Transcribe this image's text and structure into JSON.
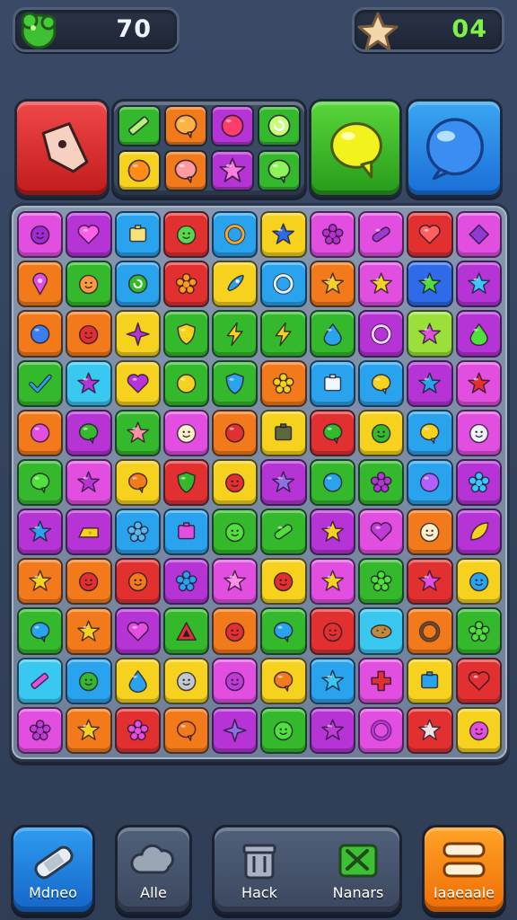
{
  "hud": {
    "score_icon": "green-blob-icon",
    "score_value": "70",
    "moves_icon": "star-icon",
    "moves_value": "04"
  },
  "boosters": [
    {
      "name": "red-tag-booster",
      "icon": "tag-icon",
      "color": "#e23333"
    },
    {
      "name": "mini-gems-booster",
      "icon": "gem-cluster-icon",
      "color": "#3a4a62"
    },
    {
      "name": "green-bubble-booster",
      "icon": "speech-bubble-icon",
      "color": "#3cc02a"
    },
    {
      "name": "blue-orb-booster",
      "icon": "orb-icon",
      "color": "#2b8ae8"
    }
  ],
  "booster_gems": [
    {
      "bg": "#35b92c",
      "icon": "pencil",
      "fg": "#b6f07a"
    },
    {
      "bg": "#f27a1b",
      "icon": "bubble",
      "fg": "#ffb347"
    },
    {
      "bg": "#b633d6",
      "icon": "circle",
      "fg": "#ff3d6b"
    },
    {
      "bg": "#35b92c",
      "icon": "swirl",
      "fg": "#c8ff7a"
    },
    {
      "bg": "#f6d21e",
      "icon": "circle",
      "fg": "#ff8b18"
    },
    {
      "bg": "#f27a1b",
      "icon": "bubble",
      "fg": "#ff9aa0"
    },
    {
      "bg": "#b633d6",
      "icon": "star",
      "fg": "#ff7ce0"
    },
    {
      "bg": "#35b92c",
      "icon": "bubble",
      "fg": "#8ff25a"
    }
  ],
  "board": {
    "rows": [
      [
        {
          "bg": "#e24fe0",
          "fg": "#a02bd0",
          "icon": "face"
        },
        {
          "bg": "#b633d6",
          "fg": "#ff5fe8",
          "icon": "heart"
        },
        {
          "bg": "#2aa3ee",
          "fg": "#f7e27a",
          "icon": "box"
        },
        {
          "bg": "#e23030",
          "fg": "#5ad84a",
          "icon": "face"
        },
        {
          "bg": "#2aa3ee",
          "fg": "#f7a62d",
          "icon": "ring"
        },
        {
          "bg": "#f6d21e",
          "fg": "#2f6ae8",
          "icon": "star"
        },
        {
          "bg": "#e24fe0",
          "fg": "#b82fd0",
          "icon": "flower"
        },
        {
          "bg": "#e24fe0",
          "fg": "#9f3ad0",
          "icon": "pill"
        },
        {
          "bg": "#e23030",
          "fg": "#ff5f5f",
          "icon": "heart"
        },
        {
          "bg": "#e24fe0",
          "fg": "#8f3ad0",
          "icon": "diamond"
        }
      ],
      [
        {
          "bg": "#f27a1b",
          "fg": "#e24fe0",
          "icon": "pin"
        },
        {
          "bg": "#35b92c",
          "fg": "#ff9a3c",
          "icon": "face"
        },
        {
          "bg": "#2aa3ee",
          "fg": "#35b92c",
          "icon": "swirl"
        },
        {
          "bg": "#e23030",
          "fg": "#ff9a1b",
          "icon": "flower"
        },
        {
          "bg": "#f6d21e",
          "fg": "#2aa3ee",
          "icon": "rocket"
        },
        {
          "bg": "#2aa3ee",
          "fg": "#e0f4ff",
          "icon": "ring"
        },
        {
          "bg": "#f27a1b",
          "fg": "#f6d21e",
          "icon": "star"
        },
        {
          "bg": "#e24fe0",
          "fg": "#f6d21e",
          "icon": "star"
        },
        {
          "bg": "#2f6ae8",
          "fg": "#4fe03a",
          "icon": "star"
        },
        {
          "bg": "#b633d6",
          "fg": "#38c8ff",
          "icon": "star"
        }
      ],
      [
        {
          "bg": "#f27a1b",
          "fg": "#3a7ef0",
          "icon": "circle"
        },
        {
          "bg": "#f27a1b",
          "fg": "#e23030",
          "icon": "face"
        },
        {
          "bg": "#f6d21e",
          "fg": "#b633d6",
          "icon": "sparkle"
        },
        {
          "bg": "#35b92c",
          "fg": "#f6d21e",
          "icon": "shield"
        },
        {
          "bg": "#35b92c",
          "fg": "#f6d21e",
          "icon": "bolt"
        },
        {
          "bg": "#35b92c",
          "fg": "#f6d21e",
          "icon": "bolt"
        },
        {
          "bg": "#35b92c",
          "fg": "#2aa3ee",
          "icon": "drop"
        },
        {
          "bg": "#b633d6",
          "fg": "#f0d0ff",
          "icon": "ring"
        },
        {
          "bg": "#9be03a",
          "fg": "#e24fe0",
          "icon": "star"
        },
        {
          "bg": "#b633d6",
          "fg": "#4fe03a",
          "icon": "drop"
        }
      ],
      [
        {
          "bg": "#35b92c",
          "fg": "#2aa3ee",
          "icon": "check"
        },
        {
          "bg": "#38c8f0",
          "fg": "#b633d6",
          "icon": "star"
        },
        {
          "bg": "#f6d21e",
          "fg": "#b633d6",
          "icon": "heart"
        },
        {
          "bg": "#35b92c",
          "fg": "#f6d21e",
          "icon": "circle"
        },
        {
          "bg": "#35b92c",
          "fg": "#2aa3ee",
          "icon": "shield"
        },
        {
          "bg": "#f27a1b",
          "fg": "#f6d21e",
          "icon": "flower"
        },
        {
          "bg": "#2aa3ee",
          "fg": "#f0f8ff",
          "icon": "box"
        },
        {
          "bg": "#2aa3ee",
          "fg": "#f6d21e",
          "icon": "bubble"
        },
        {
          "bg": "#b633d6",
          "fg": "#2aa3ee",
          "icon": "star"
        },
        {
          "bg": "#e24fe0",
          "fg": "#e23030",
          "icon": "star"
        }
      ],
      [
        {
          "bg": "#f27a1b",
          "fg": "#e24fe0",
          "icon": "circle"
        },
        {
          "bg": "#b633d6",
          "fg": "#35b92c",
          "icon": "bubble"
        },
        {
          "bg": "#35b92c",
          "fg": "#ff8fa0",
          "icon": "star"
        },
        {
          "bg": "#e24fe0",
          "fg": "#fff0c8",
          "icon": "face"
        },
        {
          "bg": "#f27a1b",
          "fg": "#e23030",
          "icon": "circle"
        },
        {
          "bg": "#f6d21e",
          "fg": "#5a6a3a",
          "icon": "box"
        },
        {
          "bg": "#e23030",
          "fg": "#35b92c",
          "icon": "bubble"
        },
        {
          "bg": "#f6d21e",
          "fg": "#35b92c",
          "icon": "face"
        },
        {
          "bg": "#2aa3ee",
          "fg": "#f6d21e",
          "icon": "bubble"
        },
        {
          "bg": "#e24fe0",
          "fg": "#f0f0ff",
          "icon": "face"
        }
      ],
      [
        {
          "bg": "#35b92c",
          "fg": "#4fe03a",
          "icon": "bubble"
        },
        {
          "bg": "#e24fe0",
          "fg": "#b633d6",
          "icon": "star"
        },
        {
          "bg": "#f6d21e",
          "fg": "#f27a1b",
          "icon": "bubble"
        },
        {
          "bg": "#e23030",
          "fg": "#35b92c",
          "icon": "shield"
        },
        {
          "bg": "#f6d21e",
          "fg": "#e23030",
          "icon": "face"
        },
        {
          "bg": "#b633d6",
          "fg": "#8f6fe8",
          "icon": "star"
        },
        {
          "bg": "#35b92c",
          "fg": "#2aa3ee",
          "icon": "circle"
        },
        {
          "bg": "#35b92c",
          "fg": "#b633d6",
          "icon": "flower"
        },
        {
          "bg": "#2aa3ee",
          "fg": "#b060ff",
          "icon": "circle"
        },
        {
          "bg": "#b633d6",
          "fg": "#38c8ff",
          "icon": "flower"
        }
      ],
      [
        {
          "bg": "#b633d6",
          "fg": "#2aa3ee",
          "icon": "star"
        },
        {
          "bg": "#b633d6",
          "fg": "#f6d21e",
          "icon": "cheese"
        },
        {
          "bg": "#2aa3ee",
          "fg": "#5ab8f0",
          "icon": "flower"
        },
        {
          "bg": "#2aa3ee",
          "fg": "#e24fe0",
          "icon": "box"
        },
        {
          "bg": "#35b92c",
          "fg": "#4fe03a",
          "icon": "face"
        },
        {
          "bg": "#35b92c",
          "fg": "#4fe03a",
          "icon": "pill"
        },
        {
          "bg": "#b633d6",
          "fg": "#f6d21e",
          "icon": "star"
        },
        {
          "bg": "#e24fe0",
          "fg": "#c03ad8",
          "icon": "heart"
        },
        {
          "bg": "#f27a1b",
          "fg": "#fff0c8",
          "icon": "face"
        },
        {
          "bg": "#b633d6",
          "fg": "#f6d21e",
          "icon": "leaf"
        }
      ],
      [
        {
          "bg": "#f27a1b",
          "fg": "#f6d21e",
          "icon": "star"
        },
        {
          "bg": "#f27a1b",
          "fg": "#e23030",
          "icon": "face"
        },
        {
          "bg": "#e23030",
          "fg": "#f27a1b",
          "icon": "face"
        },
        {
          "bg": "#b633d6",
          "fg": "#2aa3ee",
          "icon": "flower"
        },
        {
          "bg": "#e24fe0",
          "fg": "#ff8fe8",
          "icon": "star"
        },
        {
          "bg": "#f6d21e",
          "fg": "#e23030",
          "icon": "face"
        },
        {
          "bg": "#e24fe0",
          "fg": "#f6d21e",
          "icon": "star"
        },
        {
          "bg": "#35b92c",
          "fg": "#4fe03a",
          "icon": "flower"
        },
        {
          "bg": "#e23030",
          "fg": "#e24fe0",
          "icon": "star"
        },
        {
          "bg": "#f6d21e",
          "fg": "#2aa3ee",
          "icon": "face"
        }
      ],
      [
        {
          "bg": "#35b92c",
          "fg": "#2aa3ee",
          "icon": "bubble"
        },
        {
          "bg": "#f27a1b",
          "fg": "#f6d21e",
          "icon": "star"
        },
        {
          "bg": "#b633d6",
          "fg": "#e24fe0",
          "icon": "heart"
        },
        {
          "bg": "#35b92c",
          "fg": "#e23030",
          "icon": "triangle"
        },
        {
          "bg": "#f27a1b",
          "fg": "#e23030",
          "icon": "face"
        },
        {
          "bg": "#35b92c",
          "fg": "#2aa3ee",
          "icon": "bubble"
        },
        {
          "bg": "#e23030",
          "fg": "#e23030",
          "icon": "face"
        },
        {
          "bg": "#38c8f0",
          "fg": "#c08a3a",
          "icon": "cookie"
        },
        {
          "bg": "#f27a1b",
          "fg": "#6a4a2a",
          "icon": "ring"
        },
        {
          "bg": "#35b92c",
          "fg": "#4fe03a",
          "icon": "flower"
        }
      ],
      [
        {
          "bg": "#38c8f0",
          "fg": "#e24fe0",
          "icon": "pencil"
        },
        {
          "bg": "#2aa3ee",
          "fg": "#35b92c",
          "icon": "face"
        },
        {
          "bg": "#f6d21e",
          "fg": "#2aa3ee",
          "icon": "drop"
        },
        {
          "bg": "#f6d21e",
          "fg": "#c0c8d0",
          "icon": "face"
        },
        {
          "bg": "#e24fe0",
          "fg": "#c03ad8",
          "icon": "face"
        },
        {
          "bg": "#f6d21e",
          "fg": "#f27a1b",
          "icon": "bubble"
        },
        {
          "bg": "#2aa3ee",
          "fg": "#38c8f0",
          "icon": "star"
        },
        {
          "bg": "#e24fe0",
          "fg": "#e23030",
          "icon": "cross"
        },
        {
          "bg": "#f6d21e",
          "fg": "#2aa3ee",
          "icon": "box"
        },
        {
          "bg": "#e23030",
          "fg": "#e23030",
          "icon": "heart"
        }
      ],
      [
        {
          "bg": "#e24fe0",
          "fg": "#c03ad8",
          "icon": "flower"
        },
        {
          "bg": "#f27a1b",
          "fg": "#f6d21e",
          "icon": "star"
        },
        {
          "bg": "#e23030",
          "fg": "#e24fe0",
          "icon": "flower"
        },
        {
          "bg": "#f27a1b",
          "fg": "#f27a1b",
          "icon": "bubble"
        },
        {
          "bg": "#b633d6",
          "fg": "#8f6fe8",
          "icon": "sparkle"
        },
        {
          "bg": "#35b92c",
          "fg": "#4fe03a",
          "icon": "face"
        },
        {
          "bg": "#b633d6",
          "fg": "#c03ad8",
          "icon": "star"
        },
        {
          "bg": "#e24fe0",
          "fg": "#b633d6",
          "icon": "ring"
        },
        {
          "bg": "#e23030",
          "fg": "#f0e0e0",
          "icon": "star"
        },
        {
          "bg": "#f6d21e",
          "fg": "#e24fe0",
          "icon": "face"
        }
      ]
    ]
  },
  "bottom_bar": {
    "b1_label": "Mdneo",
    "b1_icon": "bandage-icon",
    "b2_label": "Alle",
    "b2_icon": "cloud-icon",
    "b3_label": "Hack",
    "b3_icon": "trash-icon",
    "b4_label": "Nanars",
    "b4_icon": "shuffle-icon",
    "b5_label": "Iaaeaale",
    "b5_icon": "menu-icon"
  }
}
